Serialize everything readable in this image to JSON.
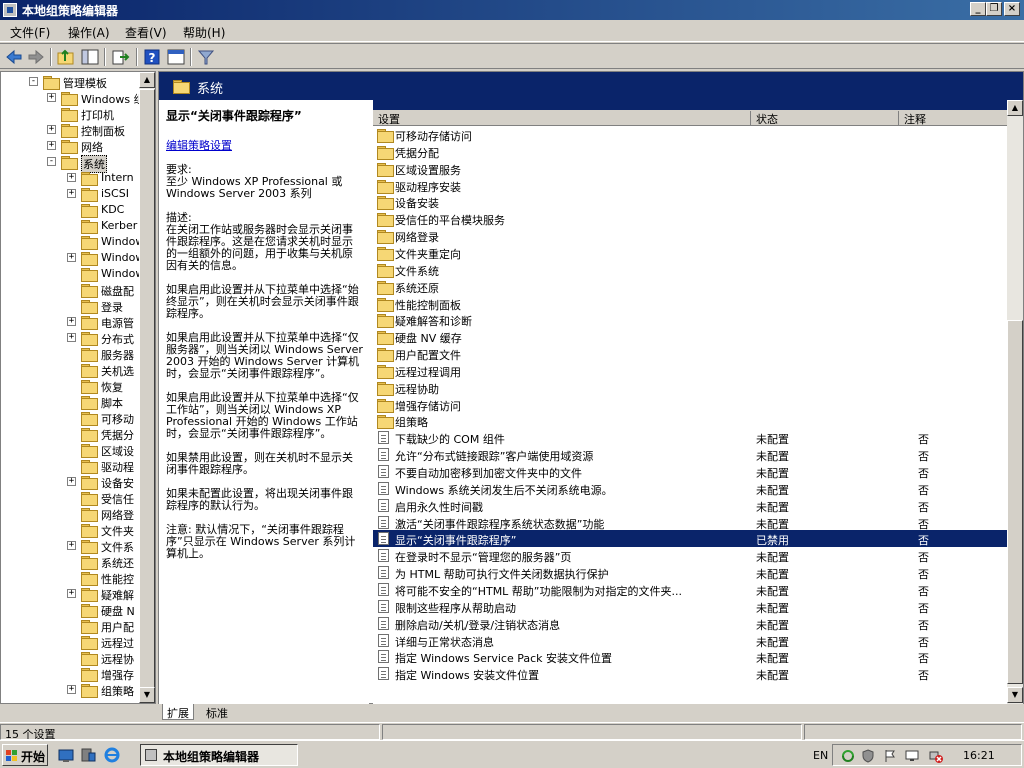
{
  "window": {
    "title": "本地组策略编辑器"
  },
  "menu": [
    "文件(F)",
    "操作(A)",
    "查看(V)",
    "帮助(H)"
  ],
  "tree": {
    "items": [
      {
        "label": "管理模板",
        "level": 0,
        "toggle": "-"
      },
      {
        "label": "Windows 组",
        "level": 1,
        "toggle": "+"
      },
      {
        "label": "打印机",
        "level": 1,
        "toggle": ""
      },
      {
        "label": "控制面板",
        "level": 1,
        "toggle": "+"
      },
      {
        "label": "网络",
        "level": 1,
        "toggle": "+"
      },
      {
        "label": "系统",
        "level": 1,
        "toggle": "-",
        "selected": true
      },
      {
        "label": "Intern",
        "level": 2,
        "toggle": "+"
      },
      {
        "label": "iSCSI",
        "level": 2,
        "toggle": "+"
      },
      {
        "label": "KDC",
        "level": 2,
        "toggle": ""
      },
      {
        "label": "Kerber",
        "level": 2,
        "toggle": ""
      },
      {
        "label": "Window",
        "level": 2,
        "toggle": ""
      },
      {
        "label": "Window",
        "level": 2,
        "toggle": "+"
      },
      {
        "label": "Window",
        "level": 2,
        "toggle": ""
      },
      {
        "label": "磁盘配",
        "level": 2,
        "toggle": ""
      },
      {
        "label": "登录",
        "level": 2,
        "toggle": ""
      },
      {
        "label": "电源管",
        "level": 2,
        "toggle": "+"
      },
      {
        "label": "分布式",
        "level": 2,
        "toggle": "+"
      },
      {
        "label": "服务器",
        "level": 2,
        "toggle": ""
      },
      {
        "label": "关机选",
        "level": 2,
        "toggle": ""
      },
      {
        "label": "恢复",
        "level": 2,
        "toggle": ""
      },
      {
        "label": "脚本",
        "level": 2,
        "toggle": ""
      },
      {
        "label": "可移动",
        "level": 2,
        "toggle": ""
      },
      {
        "label": "凭据分",
        "level": 2,
        "toggle": ""
      },
      {
        "label": "区域设",
        "level": 2,
        "toggle": ""
      },
      {
        "label": "驱动程",
        "level": 2,
        "toggle": ""
      },
      {
        "label": "设备安",
        "level": 2,
        "toggle": "+"
      },
      {
        "label": "受信任",
        "level": 2,
        "toggle": ""
      },
      {
        "label": "网络登",
        "level": 2,
        "toggle": ""
      },
      {
        "label": "文件夹",
        "level": 2,
        "toggle": ""
      },
      {
        "label": "文件系",
        "level": 2,
        "toggle": "+"
      },
      {
        "label": "系统还",
        "level": 2,
        "toggle": ""
      },
      {
        "label": "性能控",
        "level": 2,
        "toggle": ""
      },
      {
        "label": "疑难解",
        "level": 2,
        "toggle": "+"
      },
      {
        "label": "硬盘 N",
        "level": 2,
        "toggle": ""
      },
      {
        "label": "用户配",
        "level": 2,
        "toggle": ""
      },
      {
        "label": "远程过",
        "level": 2,
        "toggle": ""
      },
      {
        "label": "远程协",
        "level": 2,
        "toggle": ""
      },
      {
        "label": "增强存",
        "level": 2,
        "toggle": ""
      },
      {
        "label": "组策略",
        "level": 2,
        "toggle": "+"
      }
    ]
  },
  "right": {
    "header": "系统",
    "desc": {
      "title": "显示“关闭事件跟踪程序”",
      "link": "编辑策略设置",
      "paragraphs": [
        "要求:\n至少 Windows XP Professional 或 Windows Server 2003 系列",
        "描述:\n在关闭工作站或服务器时会显示关闭事件跟踪程序。这是在您请求关机时显示的一组额外的问题，用于收集与关机原因有关的信息。",
        "如果启用此设置并从下拉菜单中选择“始终显示”，则在关机时会显示关闭事件跟踪程序。",
        "如果启用此设置并从下拉菜单中选择“仅服务器”，则当关闭以 Windows Server 2003 开始的 Windows Server 计算机时，会显示“关闭事件跟踪程序”。",
        "如果启用此设置并从下拉菜单中选择“仅工作站”，则当关闭以 Windows XP Professional 开始的 Windows 工作站时，会显示“关闭事件跟踪程序”。",
        "如果禁用此设置，则在关机时不显示关闭事件跟踪程序。",
        "如果未配置此设置，将出现关闭事件跟踪程序的默认行为。",
        "注意: 默认情况下，“关闭事件跟踪程序”只显示在 Windows Server 系列计算机上。"
      ]
    },
    "columns": {
      "setting": "设置",
      "state": "状态",
      "comment": "注释"
    },
    "folders": [
      "可移动存储访问",
      "凭据分配",
      "区域设置服务",
      "驱动程序安装",
      "设备安装",
      "受信任的平台模块服务",
      "网络登录",
      "文件夹重定向",
      "文件系统",
      "系统还原",
      "性能控制面板",
      "疑难解答和诊断",
      "硬盘 NV 缓存",
      "用户配置文件",
      "远程过程调用",
      "远程协助",
      "增强存储访问",
      "组策略"
    ],
    "policies": [
      {
        "name": "下载缺少的 COM 组件",
        "state": "未配置",
        "comment": "否"
      },
      {
        "name": "允许“分布式链接跟踪”客户端使用域资源",
        "state": "未配置",
        "comment": "否"
      },
      {
        "name": "不要自动加密移到加密文件夹中的文件",
        "state": "未配置",
        "comment": "否"
      },
      {
        "name": "Windows 系统关闭发生后不关闭系统电源。",
        "state": "未配置",
        "comment": "否"
      },
      {
        "name": "启用永久性时间戳",
        "state": "未配置",
        "comment": "否"
      },
      {
        "name": "激活“关闭事件跟踪程序系统状态数据”功能",
        "state": "未配置",
        "comment": "否"
      },
      {
        "name": "显示“关闭事件跟踪程序”",
        "state": "已禁用",
        "comment": "否",
        "selected": true
      },
      {
        "name": "在登录时不显示“管理您的服务器”页",
        "state": "未配置",
        "comment": "否"
      },
      {
        "name": "为 HTML 帮助可执行文件关闭数据执行保护",
        "state": "未配置",
        "comment": "否"
      },
      {
        "name": "将可能不安全的“HTML 帮助”功能限制为对指定的文件夹...",
        "state": "未配置",
        "comment": "否"
      },
      {
        "name": "限制这些程序从帮助启动",
        "state": "未配置",
        "comment": "否"
      },
      {
        "name": "删除启动/关机/登录/注销状态消息",
        "state": "未配置",
        "comment": "否"
      },
      {
        "name": "详细与正常状态消息",
        "state": "未配置",
        "comment": "否"
      },
      {
        "name": "指定 Windows Service Pack 安装文件位置",
        "state": "未配置",
        "comment": "否"
      },
      {
        "name": "指定 Windows 安装文件位置",
        "state": "未配置",
        "comment": "否"
      }
    ]
  },
  "tabs": {
    "extended": "扩展",
    "standard": "标准"
  },
  "status": {
    "count": "15 个设置"
  },
  "taskbar": {
    "start": "开始",
    "task": "本地组策略编辑器",
    "lang": "EN",
    "clock": "16:21"
  }
}
